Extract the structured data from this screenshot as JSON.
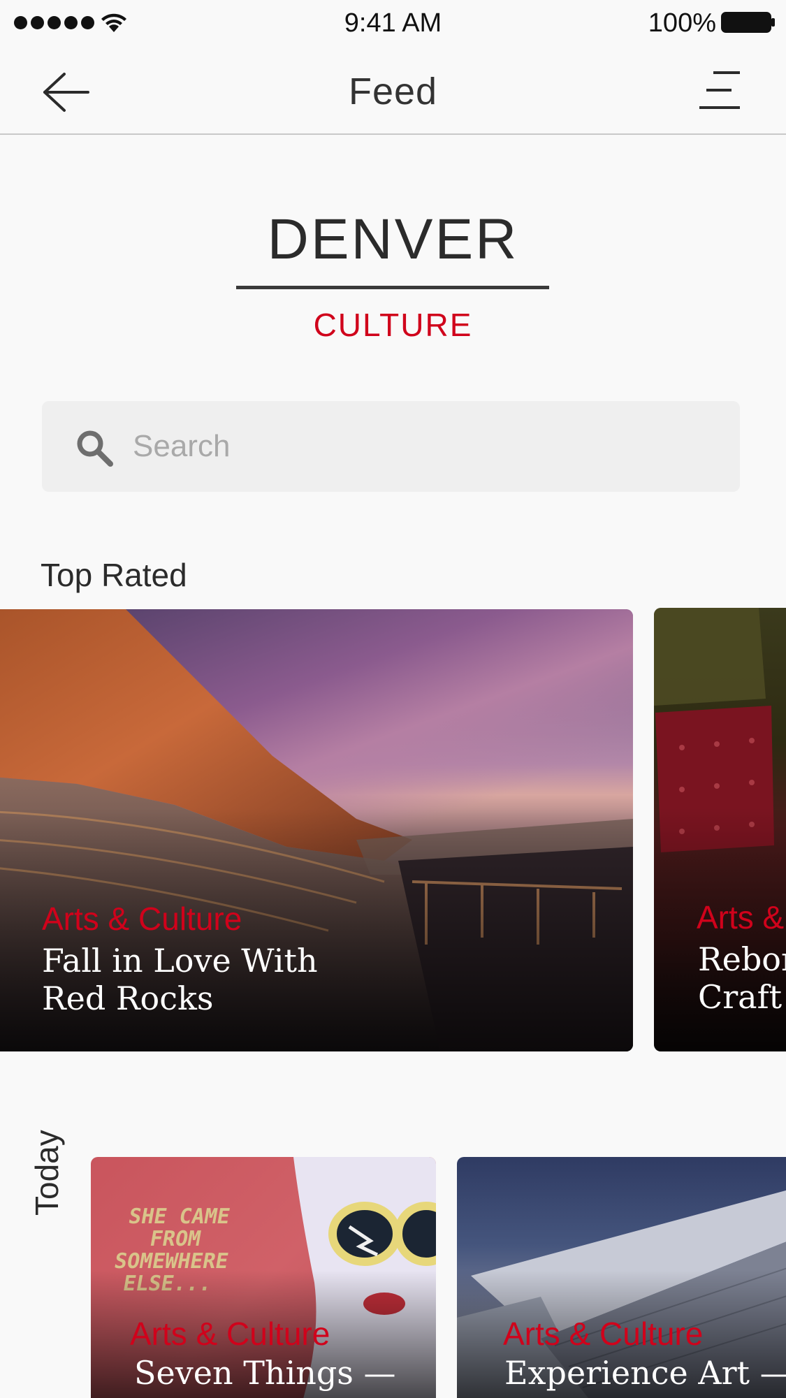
{
  "status_bar": {
    "time": "9:41 AM",
    "battery": "100%",
    "icons": [
      "signal-icon",
      "wifi-icon",
      "battery-icon"
    ]
  },
  "nav": {
    "title": "Feed",
    "back_icon": "back-arrow-icon",
    "menu_icon": "menu-icon"
  },
  "hero": {
    "city": "DENVER",
    "subtitle": "CULTURE"
  },
  "search": {
    "placeholder": "Search",
    "value": "",
    "icon": "search-icon"
  },
  "top_rated": {
    "label": "Top Rated",
    "cards": [
      {
        "category": "Arts & Culture",
        "title": "Fall in Love With\nRed Rocks"
      },
      {
        "category": "Arts &",
        "title": "Reborn\nCraft C"
      }
    ]
  },
  "today": {
    "label": "Today",
    "cards": [
      {
        "category": "Arts & Culture",
        "title": "Seven Things —",
        "mural_text": "SHE CAME\nFROM\nSOMEWHERE\nELSE..."
      },
      {
        "category": "Arts & Culture",
        "title": "Experience Art —"
      }
    ]
  },
  "colors": {
    "accent": "#d0021b",
    "background": "#f9f9f9",
    "search_bg": "#efefef"
  }
}
